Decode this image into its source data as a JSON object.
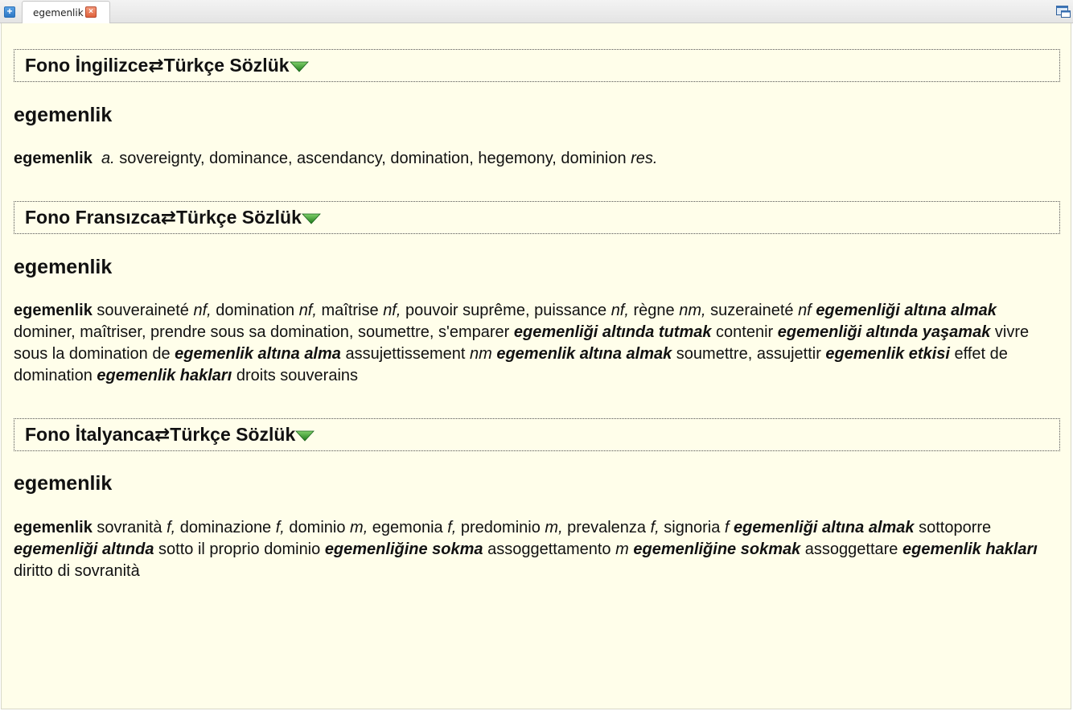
{
  "tabbar": {
    "active_tab": "egemenlik"
  },
  "sections": [
    {
      "dictionary": "Fono İngilizce⇄Türkçe Sözlük",
      "headword": "egemenlik",
      "entry": [
        {
          "t": "b",
          "v": "egemenlik"
        },
        {
          "t": "n",
          "v": "  "
        },
        {
          "t": "i",
          "v": "a."
        },
        {
          "t": "n",
          "v": " sovereignty, dominance, ascendancy, domination, hegemony, dominion "
        },
        {
          "t": "i",
          "v": "res."
        }
      ]
    },
    {
      "dictionary": "Fono Fransızca⇄Türkçe Sözlük",
      "headword": "egemenlik",
      "entry": [
        {
          "t": "b",
          "v": "egemenlik"
        },
        {
          "t": "n",
          "v": " souveraineté "
        },
        {
          "t": "i",
          "v": "nf,"
        },
        {
          "t": "n",
          "v": " domination "
        },
        {
          "t": "i",
          "v": "nf,"
        },
        {
          "t": "n",
          "v": " maîtrise "
        },
        {
          "t": "i",
          "v": "nf,"
        },
        {
          "t": "n",
          "v": " pouvoir suprême, puissance "
        },
        {
          "t": "i",
          "v": "nf,"
        },
        {
          "t": "n",
          "v": " règne "
        },
        {
          "t": "i",
          "v": "nm,"
        },
        {
          "t": "n",
          "v": " suzeraineté "
        },
        {
          "t": "i",
          "v": "nf"
        },
        {
          "t": "n",
          "v": " "
        },
        {
          "t": "p",
          "v": "egemenliği altına almak"
        },
        {
          "t": "n",
          "v": " dominer, maîtriser, prendre sous sa domination, soumettre, s'emparer "
        },
        {
          "t": "p",
          "v": "egemenliği altında tutmak"
        },
        {
          "t": "n",
          "v": " contenir "
        },
        {
          "t": "p",
          "v": "egemenliği altında yaşamak"
        },
        {
          "t": "n",
          "v": " vivre sous la domination de "
        },
        {
          "t": "p",
          "v": "egemenlik altına alma"
        },
        {
          "t": "n",
          "v": " assujettissement "
        },
        {
          "t": "i",
          "v": "nm"
        },
        {
          "t": "n",
          "v": " "
        },
        {
          "t": "p",
          "v": "egemenlik altına almak"
        },
        {
          "t": "n",
          "v": " soumettre, assujettir "
        },
        {
          "t": "p",
          "v": "egemenlik etkisi"
        },
        {
          "t": "n",
          "v": " effet de domination "
        },
        {
          "t": "p",
          "v": "egemenlik hakları"
        },
        {
          "t": "n",
          "v": " droits souverains"
        }
      ]
    },
    {
      "dictionary": "Fono İtalyanca⇄Türkçe Sözlük",
      "headword": "egemenlik",
      "entry": [
        {
          "t": "b",
          "v": "egemenlik"
        },
        {
          "t": "n",
          "v": " sovranità "
        },
        {
          "t": "i",
          "v": "f,"
        },
        {
          "t": "n",
          "v": " dominazione "
        },
        {
          "t": "i",
          "v": "f,"
        },
        {
          "t": "n",
          "v": " dominio "
        },
        {
          "t": "i",
          "v": "m,"
        },
        {
          "t": "n",
          "v": " egemonia "
        },
        {
          "t": "i",
          "v": "f,"
        },
        {
          "t": "n",
          "v": " predominio "
        },
        {
          "t": "i",
          "v": "m,"
        },
        {
          "t": "n",
          "v": " prevalenza "
        },
        {
          "t": "i",
          "v": "f,"
        },
        {
          "t": "n",
          "v": " signoria "
        },
        {
          "t": "i",
          "v": "f"
        },
        {
          "t": "n",
          "v": " "
        },
        {
          "t": "p",
          "v": "egemenliği altına almak"
        },
        {
          "t": "n",
          "v": " sottoporre "
        },
        {
          "t": "p",
          "v": "egemenliği altında"
        },
        {
          "t": "n",
          "v": " sotto il proprio dominio "
        },
        {
          "t": "p",
          "v": "egemenliğine sokma"
        },
        {
          "t": "n",
          "v": " assoggettamento "
        },
        {
          "t": "i",
          "v": "m"
        },
        {
          "t": "n",
          "v": " "
        },
        {
          "t": "p",
          "v": "egemenliğine sokmak"
        },
        {
          "t": "n",
          "v": " assoggettare "
        },
        {
          "t": "p",
          "v": "egemenlik hakları"
        },
        {
          "t": "n",
          "v": " diritto di sovranità"
        }
      ]
    }
  ]
}
